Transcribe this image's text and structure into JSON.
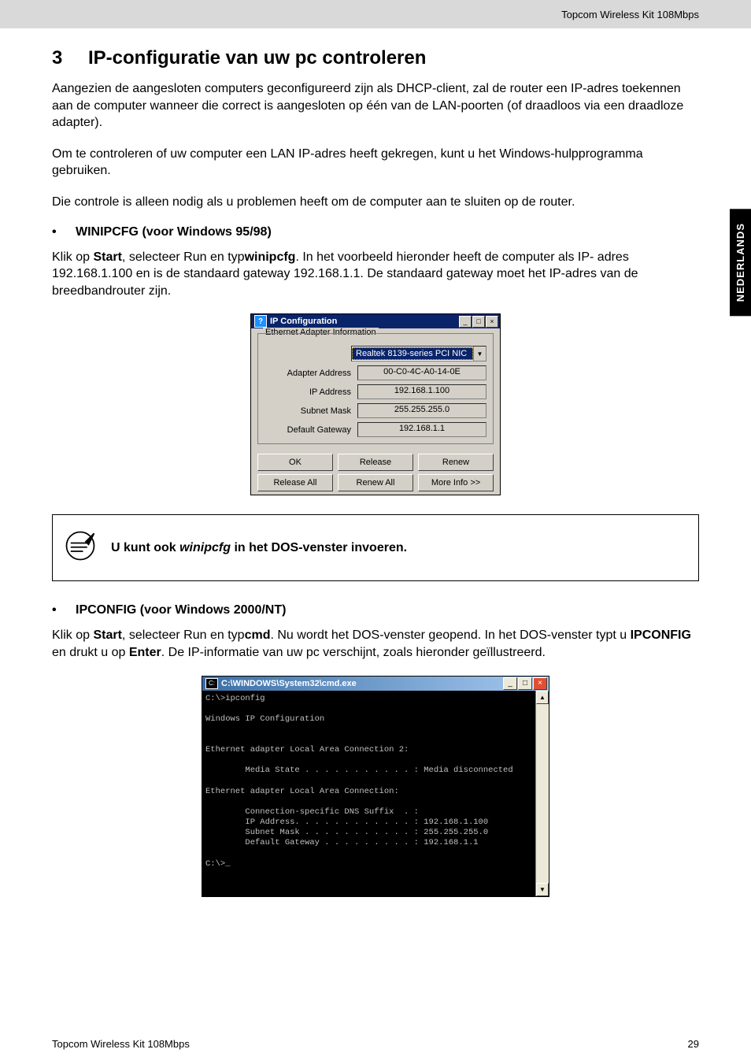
{
  "header": {
    "product": "Topcom Wireless Kit 108Mbps"
  },
  "sideTab": "NEDERLANDS",
  "section": {
    "number": "3",
    "title": "IP-configuratie van uw pc controleren"
  },
  "para1": "Aangezien de aangesloten computers geconfigureerd zijn als DHCP-client, zal de router een IP-adres toekennen aan de computer wanneer die correct is aangesloten op één van de LAN-poorten (of draadloos via een draadloze adapter).",
  "para2": "Om te controleren of uw computer een LAN IP-adres heeft gekregen, kunt u het Windows-hulpprogramma gebruiken.",
  "para3": "Die controle is alleen nodig als u problemen heeft om de computer aan te sluiten op de router.",
  "bullet1": {
    "label": "WINIPCFG (voor Windows 95/98)"
  },
  "winipcfg_intro": {
    "pre": "Klik op ",
    "b1": "Start",
    "mid1": ", selecteer Run en typ",
    "b2": "winipcfg",
    "post": ". In het voorbeeld hieronder heeft de computer als IP- adres 192.168.1.100 en is de standaard gateway 192.168.1.1. De standaard gateway moet het IP-adres van de breedbandrouter zijn."
  },
  "ipconfigWindow": {
    "title": "IP Configuration",
    "group": "Ethernet Adapter Information",
    "adapterSelected": "Realtek 8139-series PCI NIC",
    "rows": {
      "adapterAddressLabel": "Adapter Address",
      "adapterAddressValue": "00-C0-4C-A0-14-0E",
      "ipLabel": "IP Address",
      "ipValue": "192.168.1.100",
      "subnetLabel": "Subnet Mask",
      "subnetValue": "255.255.255.0",
      "gatewayLabel": "Default Gateway",
      "gatewayValue": "192.168.1.1"
    },
    "buttons": {
      "ok": "OK",
      "release": "Release",
      "renew": "Renew",
      "releaseAll": "Release All",
      "renewAll": "Renew All",
      "moreInfo": "More Info >>"
    }
  },
  "note": {
    "pre": "U kunt ook ",
    "em": "winipcfg",
    "post": " in het DOS-venster invoeren."
  },
  "bullet2": {
    "label": "IPCONFIG (voor Windows 2000/NT)"
  },
  "ipconfig_intro": {
    "pre": "Klik op ",
    "b1": "Start",
    "mid1": ", selecteer Run en typ",
    "b2": "cmd",
    "mid2": ". Nu wordt het DOS-venster geopend. In het DOS-venster typt u ",
    "b3": "IPCONFIG",
    "mid3": " en drukt u op ",
    "b4": "Enter",
    "post": ". De IP-informatie van uw pc verschijnt, zoals hieronder geïllustreerd."
  },
  "cmdWindow": {
    "title": "C:\\WINDOWS\\System32\\cmd.exe",
    "content": "C:\\>ipconfig\n\nWindows IP Configuration\n\n\nEthernet adapter Local Area Connection 2:\n\n        Media State . . . . . . . . . . . : Media disconnected\n\nEthernet adapter Local Area Connection:\n\n        Connection-specific DNS Suffix  . :\n        IP Address. . . . . . . . . . . . : 192.168.1.100\n        Subnet Mask . . . . . . . . . . . : 255.255.255.0\n        Default Gateway . . . . . . . . . : 192.168.1.1\n\nC:\\>_"
  },
  "footer": {
    "left": "Topcom Wireless Kit 108Mbps",
    "right": "29"
  }
}
